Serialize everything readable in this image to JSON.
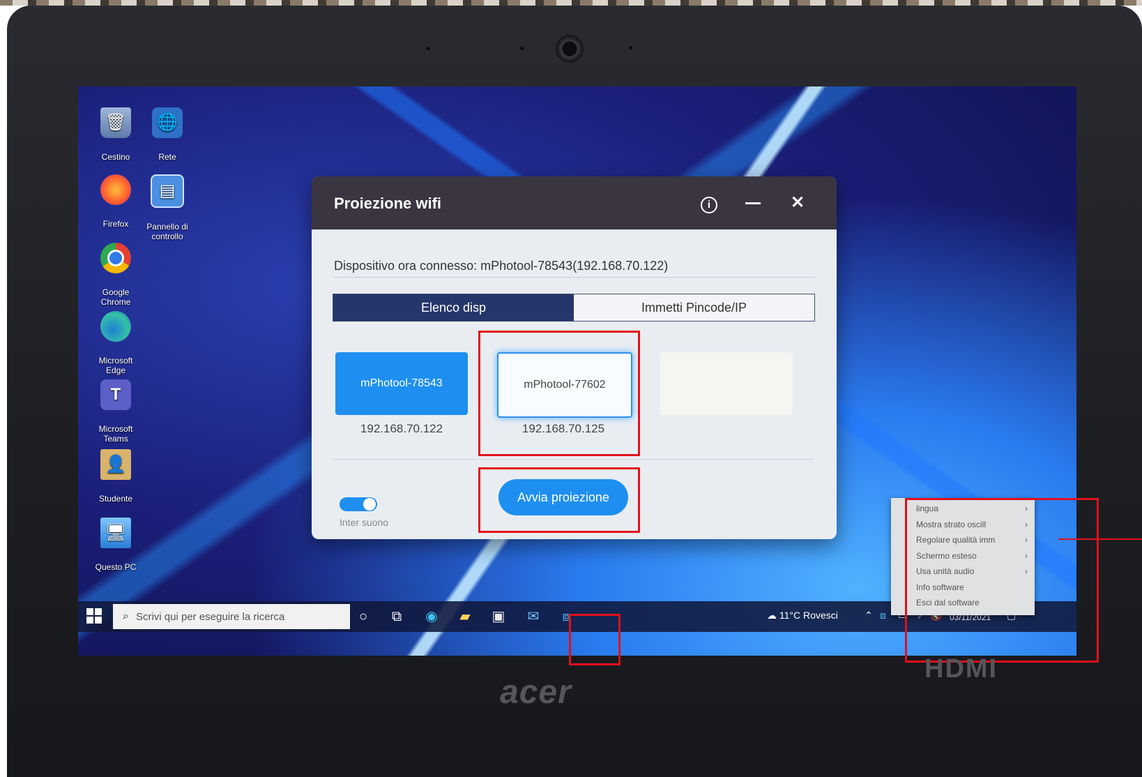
{
  "desktop": {
    "icons": [
      {
        "label": "Cestino",
        "icon": "recycle-bin-icon"
      },
      {
        "label": "Rete",
        "icon": "network-icon"
      },
      {
        "label": "Firefox",
        "icon": "firefox-icon"
      },
      {
        "label": "Pannello di\ncontrollo",
        "icon": "control-panel-icon"
      },
      {
        "label": "Google\nChrome",
        "icon": "chrome-icon"
      },
      {
        "label": "Microsoft\nEdge",
        "icon": "edge-icon"
      },
      {
        "label": "Microsoft\nTeams",
        "icon": "teams-icon"
      },
      {
        "label": "Studente",
        "icon": "user-folder-icon"
      },
      {
        "label": "Questo PC",
        "icon": "computer-icon"
      }
    ]
  },
  "dialog": {
    "title": "Proiezione wifi",
    "connected_text": "Dispositivo ora connesso: mPhotool-78543(192.168.70.122)",
    "tabs": [
      {
        "label": "Elenco disp",
        "active": true
      },
      {
        "label": "Immetti Pincode/IP",
        "active": false
      }
    ],
    "devices": [
      {
        "name": "mPhotool-78543",
        "ip": "192.168.70.122",
        "state": "selected"
      },
      {
        "name": "mPhotool-77602",
        "ip": "192.168.70.125",
        "state": "hover"
      },
      {
        "name": "",
        "ip": "",
        "state": "empty"
      }
    ],
    "toggle_label": "Inter suono",
    "toggle_on": true,
    "start_button": "Avvia proiezione"
  },
  "taskbar": {
    "search_placeholder": "Scrivi qui per eseguire la ricerca",
    "weather": "11°C  Rovesci",
    "date": "03/11/2021"
  },
  "context_menu": {
    "items": [
      {
        "label": "lingua",
        "submenu": true
      },
      {
        "label": "Mostra strato oscill",
        "submenu": true
      },
      {
        "label": "Regolare qualità imm",
        "submenu": true
      },
      {
        "label": "Schermo esteso",
        "submenu": true
      },
      {
        "label": "Usa unità audio",
        "submenu": true
      },
      {
        "label": "Info software",
        "submenu": false
      },
      {
        "label": "Esci dal software",
        "submenu": false
      }
    ]
  },
  "hardware": {
    "brand": "acer",
    "port_label": "HDMI"
  },
  "colors": {
    "accent": "#1e8ff0",
    "highlight_box": "#e3101a",
    "dialog_header": "#3a3540",
    "active_tab": "#25366a"
  }
}
